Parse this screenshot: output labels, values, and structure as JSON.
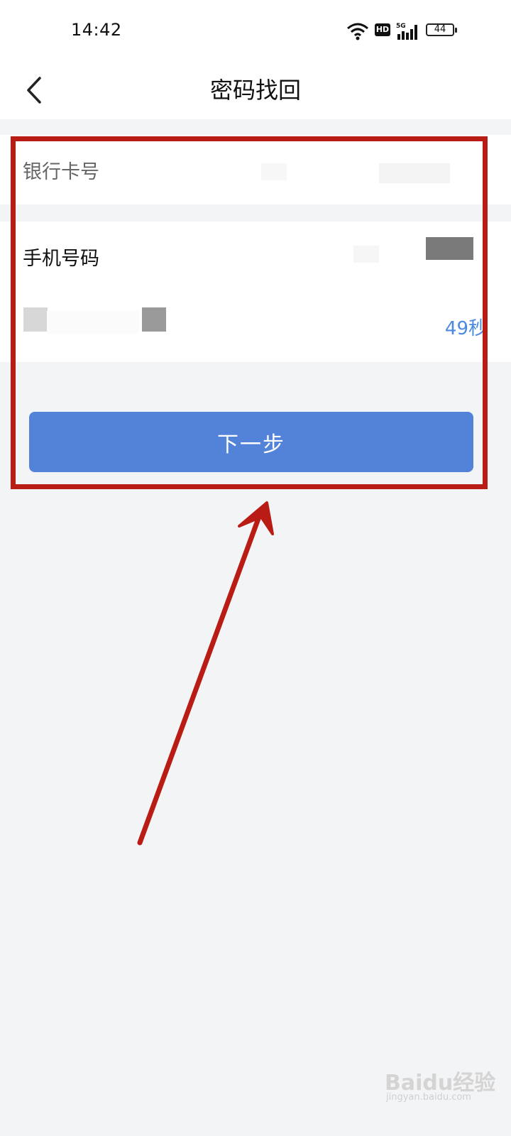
{
  "status": {
    "time": "14:42",
    "battery": "44",
    "network": "5G",
    "hd": "HD"
  },
  "nav": {
    "title": "密码找回"
  },
  "form": {
    "bank_label": "银行卡号",
    "phone_label": "手机号码",
    "countdown": "49秒",
    "next_label": "下一步"
  },
  "colors": {
    "accent": "#5383d8",
    "highlight": "#b81c14",
    "link": "#4a8ae0"
  },
  "watermark": {
    "logo": "Baidu经验",
    "url": "jingyan.baidu.com"
  }
}
